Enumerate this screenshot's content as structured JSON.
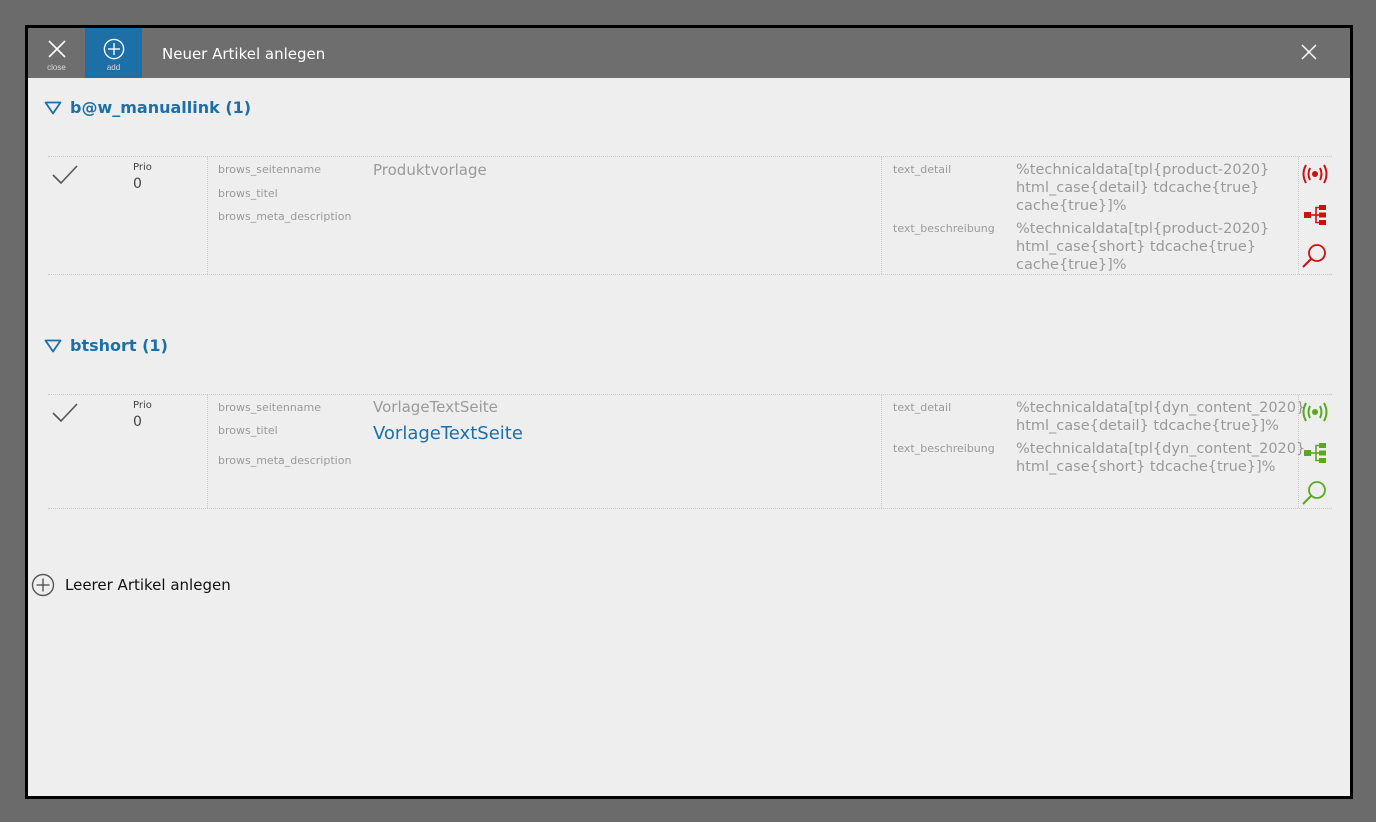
{
  "toolbar": {
    "close_label": "close",
    "add_label": "add",
    "title": "Neuer Artikel anlegen"
  },
  "groups": [
    {
      "heading": "b@w_manuallink (1)",
      "status_color": "#cc1111",
      "row": {
        "prio_label": "Prio",
        "prio_value": "0",
        "field_labels": [
          "brows_seitenname",
          "brows_titel",
          "brows_meta_description"
        ],
        "seitenname_value": "Produktvorlage",
        "titel_value": "",
        "text_detail_label": "text_detail",
        "text_detail_value": "%technicaldata[tpl{product-2020} html_case{detail} tdcache{true} cache{true}]%",
        "text_beschreibung_label": "text_beschreibung",
        "text_beschreibung_value": "%technicaldata[tpl{product-2020} html_case{short} tdcache{true} cache{true}]%"
      }
    },
    {
      "heading": "btshort (1)",
      "status_color": "#5aa81e",
      "row": {
        "prio_label": "Prio",
        "prio_value": "0",
        "field_labels": [
          "brows_seitenname",
          "brows_titel",
          "brows_meta_description"
        ],
        "seitenname_value": "VorlageTextSeite",
        "titel_value": "VorlageTextSeite",
        "text_detail_label": "text_detail",
        "text_detail_value": "%technicaldata[tpl{dyn_content_2020} html_case{detail} tdcache{true}]%",
        "text_beschreibung_label": "text_beschreibung",
        "text_beschreibung_value": "%technicaldata[tpl{dyn_content_2020} html_case{short} tdcache{true}]%"
      }
    }
  ],
  "add_empty_label": "Leerer Artikel anlegen",
  "colors": {
    "accent": "#1d6fa8",
    "titlebar": "#6e6e6e"
  },
  "icons": [
    "close-icon",
    "add-circle-icon",
    "triangle-down-icon",
    "check-icon",
    "broadcast-icon",
    "sitemap-icon",
    "search-icon"
  ]
}
